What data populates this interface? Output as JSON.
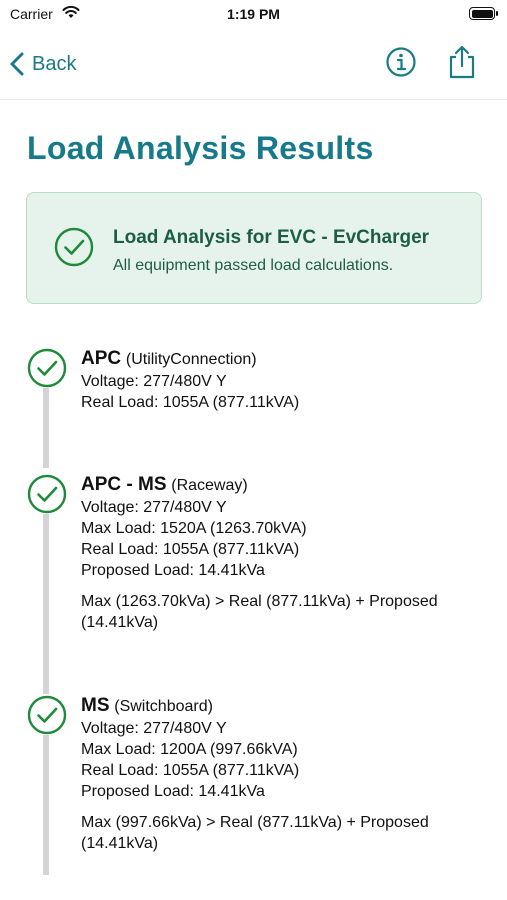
{
  "status_bar": {
    "carrier": "Carrier",
    "time": "1:19 PM"
  },
  "nav": {
    "back_label": "Back"
  },
  "page_title": "Load Analysis Results",
  "summary": {
    "title": "Load Analysis for EVC - EvCharger",
    "subtitle": "All equipment passed load calculations."
  },
  "colors": {
    "accent": "#167a8a",
    "success": "#1e8a3a",
    "card_bg": "#e6f3ec",
    "card_text": "#1d5d46"
  },
  "items": [
    {
      "name": "APC",
      "type": "(UtilityConnection)",
      "lines": [
        "Voltage: 277/480V Y",
        "Real Load: 1055A (877.11kVA)"
      ],
      "note": ""
    },
    {
      "name": "APC - MS",
      "type": "(Raceway)",
      "lines": [
        "Voltage: 277/480V Y",
        "Max Load: 1520A (1263.70kVA)",
        "Real Load: 1055A (877.11kVA)",
        "Proposed Load: 14.41kVa"
      ],
      "note": "Max (1263.70kVa) > Real (877.11kVa) + Proposed (14.41kVa)"
    },
    {
      "name": "MS",
      "type": "(Switchboard)",
      "lines": [
        "Voltage: 277/480V Y",
        "Max Load: 1200A (997.66kVA)",
        "Real Load: 1055A (877.11kVA)",
        "Proposed Load: 14.41kVa"
      ],
      "note": "Max (997.66kVa) > Real (877.11kVa) + Proposed (14.41kVa)"
    }
  ]
}
